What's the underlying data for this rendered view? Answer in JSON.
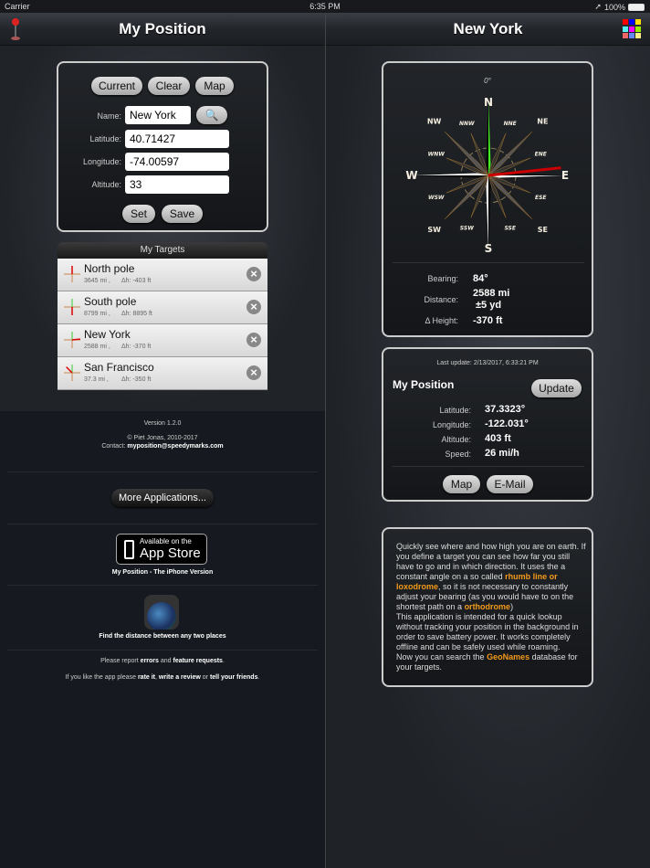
{
  "status": {
    "carrier": "Carrier",
    "time": "6:35 PM",
    "battery": "100%"
  },
  "left_nav": {
    "title": "My Position",
    "icon": "map-pin-icon"
  },
  "right_nav": {
    "title": "New York",
    "icon": "color-grid-icon",
    "grid_colors": [
      "#ff0000",
      "#0000ff",
      "#ffdd00",
      "#55eeee",
      "#ff00ff",
      "#99ee00",
      "#ee6666",
      "#6688ff",
      "#ffee88"
    ]
  },
  "form": {
    "buttons": {
      "current": "Current",
      "clear": "Clear",
      "map": "Map",
      "set": "Set",
      "save": "Save"
    },
    "name_label": "Name:",
    "name": "New York",
    "lat_label": "Latitude:",
    "lat": "40.71427",
    "lon_label": "Longitude:",
    "lon": "-74.00597",
    "alt_label": "Altitude:",
    "alt": "33"
  },
  "targets": {
    "title": "My Targets",
    "items": [
      {
        "name": "North pole",
        "dist": "3645 mi ,",
        "dh": "Δh: -403 ft"
      },
      {
        "name": "South pole",
        "dist": "8799 mi ,",
        "dh": "Δh: 8895 ft"
      },
      {
        "name": "New York",
        "dist": "2588 mi ,",
        "dh": "Δh: -370 ft"
      },
      {
        "name": "San Francisco",
        "dist": "37.3 mi ,",
        "dh": "Δh: -350 ft"
      }
    ]
  },
  "about": {
    "version": "Version 1.2.0",
    "copyright": "© Piet Jonas, 2010-2017",
    "contact_label": "Contact:",
    "contact": "myposition@speedymarks.com",
    "more_apps": "More Applications...",
    "appstore_small": "Available on the",
    "appstore_big": "App Store",
    "iphone_version": "My Position - The iPhone Version",
    "distance_app": "Find the distance between any two places",
    "report": [
      "Please report ",
      "errors",
      " and ",
      "feature requests",
      "."
    ],
    "rate": [
      "If you like the app please ",
      "rate it",
      ", ",
      "write a review",
      " or ",
      "tell your friends",
      "."
    ]
  },
  "compass": {
    "heading": "0°",
    "labels": {
      "N": "N",
      "S": "S",
      "E": "E",
      "W": "W",
      "NE": "NE",
      "NW": "NW",
      "SE": "SE",
      "SW": "SW",
      "NNE": "NNE",
      "NNW": "NNW",
      "ENE": "ENE",
      "ESE": "ESE",
      "SSE": "SSE",
      "SSW": "SSW",
      "WNW": "WNW",
      "WSW": "WSW"
    },
    "bearing_label": "Bearing:",
    "bearing": "84°",
    "distance_label": "Distance:",
    "distance": "2588 mi",
    "accuracy": "±5 yd",
    "height_label": "Δ Height:",
    "height": "-370 ft"
  },
  "position": {
    "last_update": "Last update: 2/13/2017, 6:33:21 PM",
    "title": "My Position",
    "update": "Update",
    "lat_label": "Latitude:",
    "lat": "37.3323°",
    "lon_label": "Longitude:",
    "lon": "-122.031°",
    "alt_label": "Altitude:",
    "alt": "403 ft",
    "speed_label": "Speed:",
    "speed": "26 mi/h",
    "map": "Map",
    "email": "E-Mail"
  },
  "description": [
    {
      "t": "Quickly see where and how high you are on earth. If you define a target you can see how far you still have to go and in which direction. It uses the a constant angle on a so called "
    },
    {
      "t": "rhumb line or loxodrome",
      "link": true
    },
    {
      "t": ", so it is not necessary to constantly adjust your bearing (as you would have to on the shortest path on a "
    },
    {
      "t": "orthodrome",
      "link": true
    },
    {
      "t": ")\nThis application is intended for a quick lookup without tracking your position in the background in order to save battery power. It works completely offline and can be safely used while roaming.\nNow you can search the "
    },
    {
      "t": "GeoNames",
      "link": true
    },
    {
      "t": " database for your targets."
    }
  ],
  "colors": {
    "accent": "#f39a1a",
    "needle_north": "#33ee22",
    "needle_target": "#cc0000"
  }
}
